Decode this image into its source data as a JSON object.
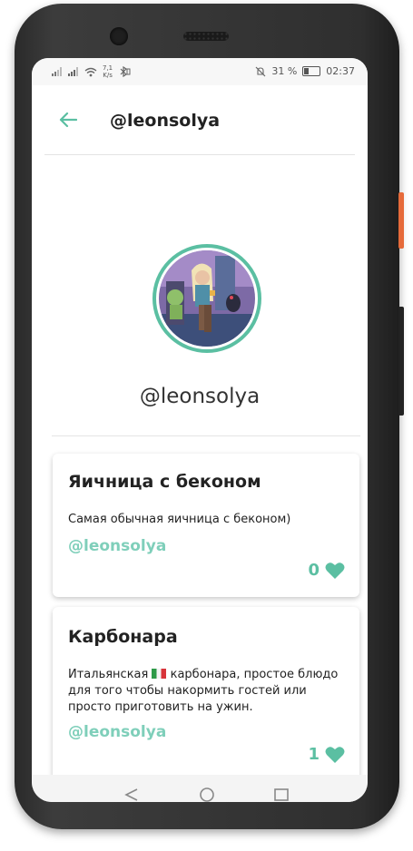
{
  "status_bar": {
    "speed": "7,1",
    "speed_unit": "K/s",
    "battery": "31 %",
    "time": "02:37"
  },
  "app_bar": {
    "title": "@leonsolya",
    "back_icon": "arrow-left-icon"
  },
  "profile": {
    "username": "@leonsolya"
  },
  "recipes": [
    {
      "title": "Яичница с беконом",
      "description": "Самая обычная яичница с беконом)",
      "author": "@leonsolya",
      "likes": "0"
    },
    {
      "title": "Карбонара",
      "description_before_flag": "Итальянская ",
      "description_after_flag": " карбонара, простое блюдо для того чтобы накормить гостей или просто приготовить на ужин.",
      "author": "@leonsolya",
      "likes": "1"
    }
  ],
  "colors": {
    "accent": "#5bbfa2",
    "author": "#7fcfba"
  }
}
